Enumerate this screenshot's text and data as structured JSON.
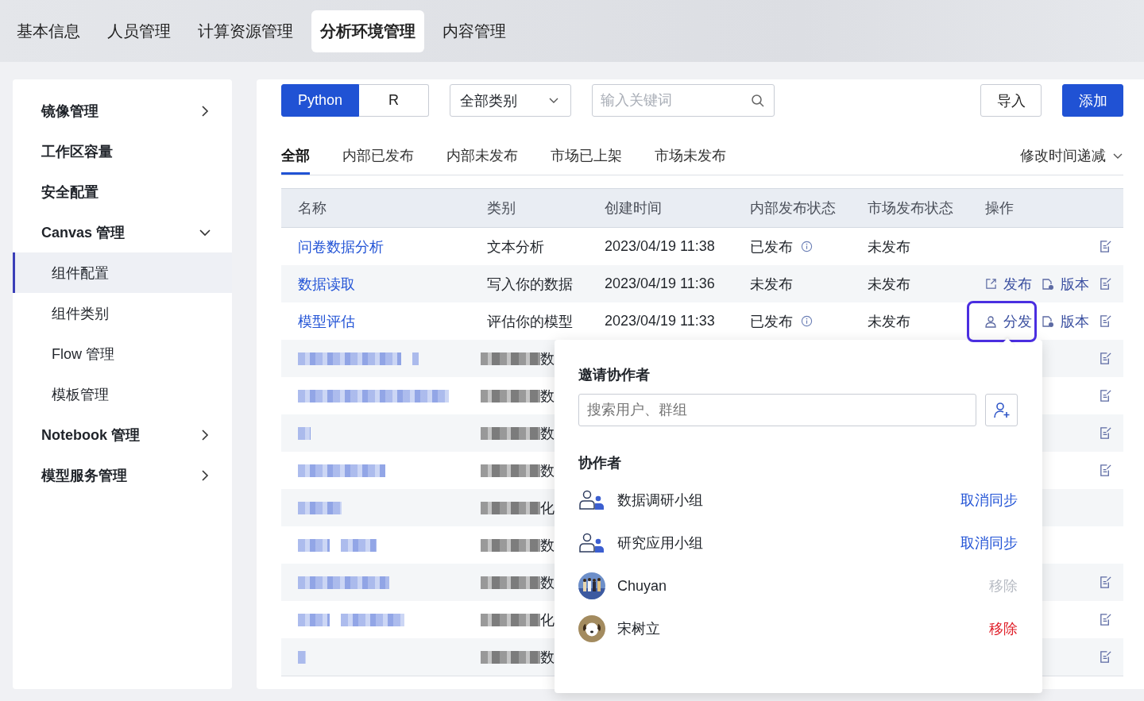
{
  "top_nav": [
    {
      "label": "基本信息",
      "selected": false
    },
    {
      "label": "人员管理",
      "selected": false
    },
    {
      "label": "计算资源管理",
      "selected": false
    },
    {
      "label": "分析环境管理",
      "selected": true
    },
    {
      "label": "内容管理",
      "selected": false
    }
  ],
  "sidebar": {
    "items": [
      {
        "label": "镜像管理",
        "expanded": false,
        "selected": false
      },
      {
        "label": "工作区容量",
        "selected": false
      },
      {
        "label": "安全配置",
        "selected": false
      },
      {
        "label": "Canvas 管理",
        "expanded": true,
        "selected": false,
        "children": [
          {
            "label": "组件配置",
            "selected": true
          },
          {
            "label": "组件类别",
            "selected": false
          },
          {
            "label": "Flow 管理",
            "selected": false
          },
          {
            "label": "模板管理",
            "selected": false
          }
        ]
      },
      {
        "label": "Notebook 管理",
        "expanded": false,
        "selected": false
      },
      {
        "label": "模型服务管理",
        "expanded": false,
        "selected": false
      }
    ]
  },
  "toolbar": {
    "language": [
      {
        "label": "Python",
        "selected": true
      },
      {
        "label": "R",
        "selected": false
      }
    ],
    "category_select": {
      "value": "全部类别"
    },
    "search": {
      "placeholder": "输入关键词"
    },
    "buttons": [
      {
        "label": "导入",
        "kind": "default"
      },
      {
        "label": "添加",
        "kind": "primary"
      }
    ]
  },
  "filter_tabs": [
    {
      "label": "全部",
      "selected": true
    },
    {
      "label": "内部已发布",
      "selected": false
    },
    {
      "label": "内部未发布",
      "selected": false
    },
    {
      "label": "市场已上架",
      "selected": false
    },
    {
      "label": "市场未发布",
      "selected": false
    }
  ],
  "sort": {
    "value": "修改时间递减"
  },
  "table": {
    "columns": [
      "名称",
      "类别",
      "创建时间",
      "内部发布状态",
      "市场发布状态",
      "操作"
    ],
    "rows": [
      {
        "kind": "clear",
        "name": "问卷数据分析",
        "category": "文本分析",
        "created": "2023/04/19 11:38",
        "internal_status": "已发布",
        "internal_info": true,
        "market_status": "未发布",
        "actions": [],
        "editable": true
      },
      {
        "kind": "clear",
        "name": "数据读取",
        "category": "写入你的数据",
        "created": "2023/04/19 11:36",
        "internal_status": "未发布",
        "internal_info": false,
        "market_status": "未发布",
        "actions": [
          {
            "label": "发布",
            "kind": "publish",
            "highlighted": false
          },
          {
            "label": "版本",
            "kind": "version",
            "highlighted": false
          }
        ],
        "editable": true
      },
      {
        "kind": "clear",
        "name": "模型评估",
        "category": "评估你的模型",
        "created": "2023/04/19 11:33",
        "internal_status": "已发布",
        "internal_info": true,
        "market_status": "未发布",
        "actions": [
          {
            "label": "分发",
            "kind": "share",
            "highlighted": true
          },
          {
            "label": "版本",
            "kind": "version",
            "highlighted": false
          }
        ],
        "editable": true
      },
      {
        "kind": "blurred",
        "category_tail": "数",
        "editable": true
      },
      {
        "kind": "blurred",
        "category_tail": "数",
        "editable": true
      },
      {
        "kind": "blurred",
        "category_tail": "数",
        "editable": true
      },
      {
        "kind": "blurred",
        "category_tail": "数",
        "editable": true
      },
      {
        "kind": "blurred",
        "category_tail": "化",
        "editable": false
      },
      {
        "kind": "blurred",
        "category_tail": "数",
        "editable": false
      },
      {
        "kind": "blurred",
        "category_tail": "数",
        "editable": true
      },
      {
        "kind": "blurred",
        "category_tail": "化",
        "editable": true
      },
      {
        "kind": "blurred",
        "category_tail": "数",
        "editable": true
      }
    ]
  },
  "share_popover": {
    "title": "邀请协作者",
    "search": {
      "placeholder": "搜索用户、群组"
    },
    "section_title": "协作者",
    "collaborators": [
      {
        "kind": "group",
        "name": "数据调研小组",
        "action": {
          "label": "取消同步",
          "kind": "link"
        }
      },
      {
        "kind": "group",
        "name": "研究应用小组",
        "action": {
          "label": "取消同步",
          "kind": "link"
        }
      },
      {
        "name": "Chuyan",
        "action": {
          "label": "移除",
          "kind": "disabled"
        }
      },
      {
        "kind": "avatar",
        "name": "宋树立",
        "action": {
          "label": "移除",
          "kind": "danger"
        }
      }
    ]
  }
}
